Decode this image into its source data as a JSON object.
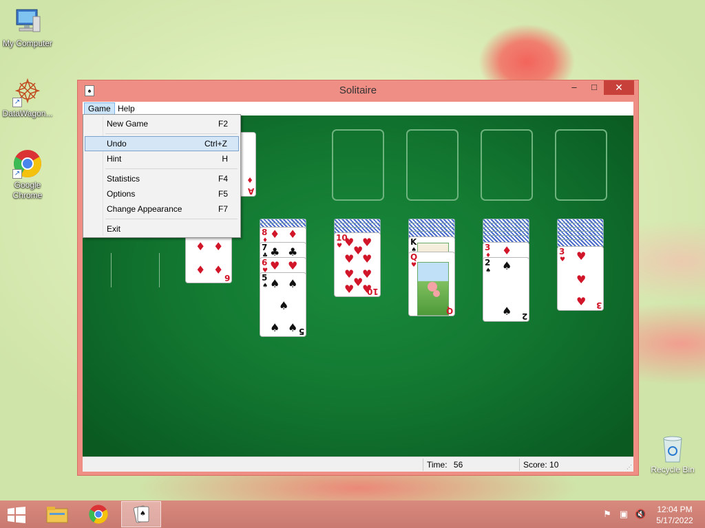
{
  "desktop": {
    "icons": [
      {
        "label": "My Computer"
      },
      {
        "label": "DataWagon..."
      },
      {
        "label": "Google\nChrome"
      },
      {
        "label": "Recycle Bin"
      }
    ]
  },
  "window": {
    "title": "Solitaire",
    "controls": {
      "minimize": "‒",
      "maximize": "□",
      "close": "✕"
    }
  },
  "menubar": {
    "items": [
      {
        "label": "Game"
      },
      {
        "label": "Help"
      }
    ]
  },
  "game_menu": {
    "items": [
      {
        "label": "New Game",
        "shortcut": "F2"
      },
      {
        "label": "Undo",
        "shortcut": "Ctrl+Z",
        "highlighted": true
      },
      {
        "label": "Hint",
        "shortcut": "H"
      },
      {
        "label": "Statistics",
        "shortcut": "F4"
      },
      {
        "label": "Options",
        "shortcut": "F5"
      },
      {
        "label": "Change Appearance",
        "shortcut": "F7"
      },
      {
        "label": "Exit",
        "shortcut": ""
      }
    ]
  },
  "status": {
    "time_label": "Time:",
    "time_value": "56",
    "score_label": "Score: 10"
  },
  "board": {
    "waste_top": {
      "rank": "A",
      "suit": "♦"
    },
    "tableau": [
      {
        "face_up": [
          {
            "rank": "6",
            "suit": "♦"
          }
        ]
      },
      {
        "face_up": [
          {
            "rank": "8",
            "suit": "♦"
          },
          {
            "rank": "7",
            "suit": "♣"
          },
          {
            "rank": "6",
            "suit": "♥"
          },
          {
            "rank": "5",
            "suit": "♠"
          }
        ]
      },
      {
        "face_up": [
          {
            "rank": "10",
            "suit": "♥"
          }
        ]
      },
      {
        "face_up": [
          {
            "rank": "K",
            "suit": "♠"
          },
          {
            "rank": "Q",
            "suit": "♥"
          }
        ]
      },
      {
        "face_up": [
          {
            "rank": "3",
            "suit": "♦"
          },
          {
            "rank": "2",
            "suit": "♠"
          }
        ]
      },
      {
        "face_up": [
          {
            "rank": "3",
            "suit": "♥"
          }
        ]
      }
    ]
  },
  "taskbar": {
    "clock_time": "12:04 PM",
    "clock_date": "5/17/2022"
  }
}
